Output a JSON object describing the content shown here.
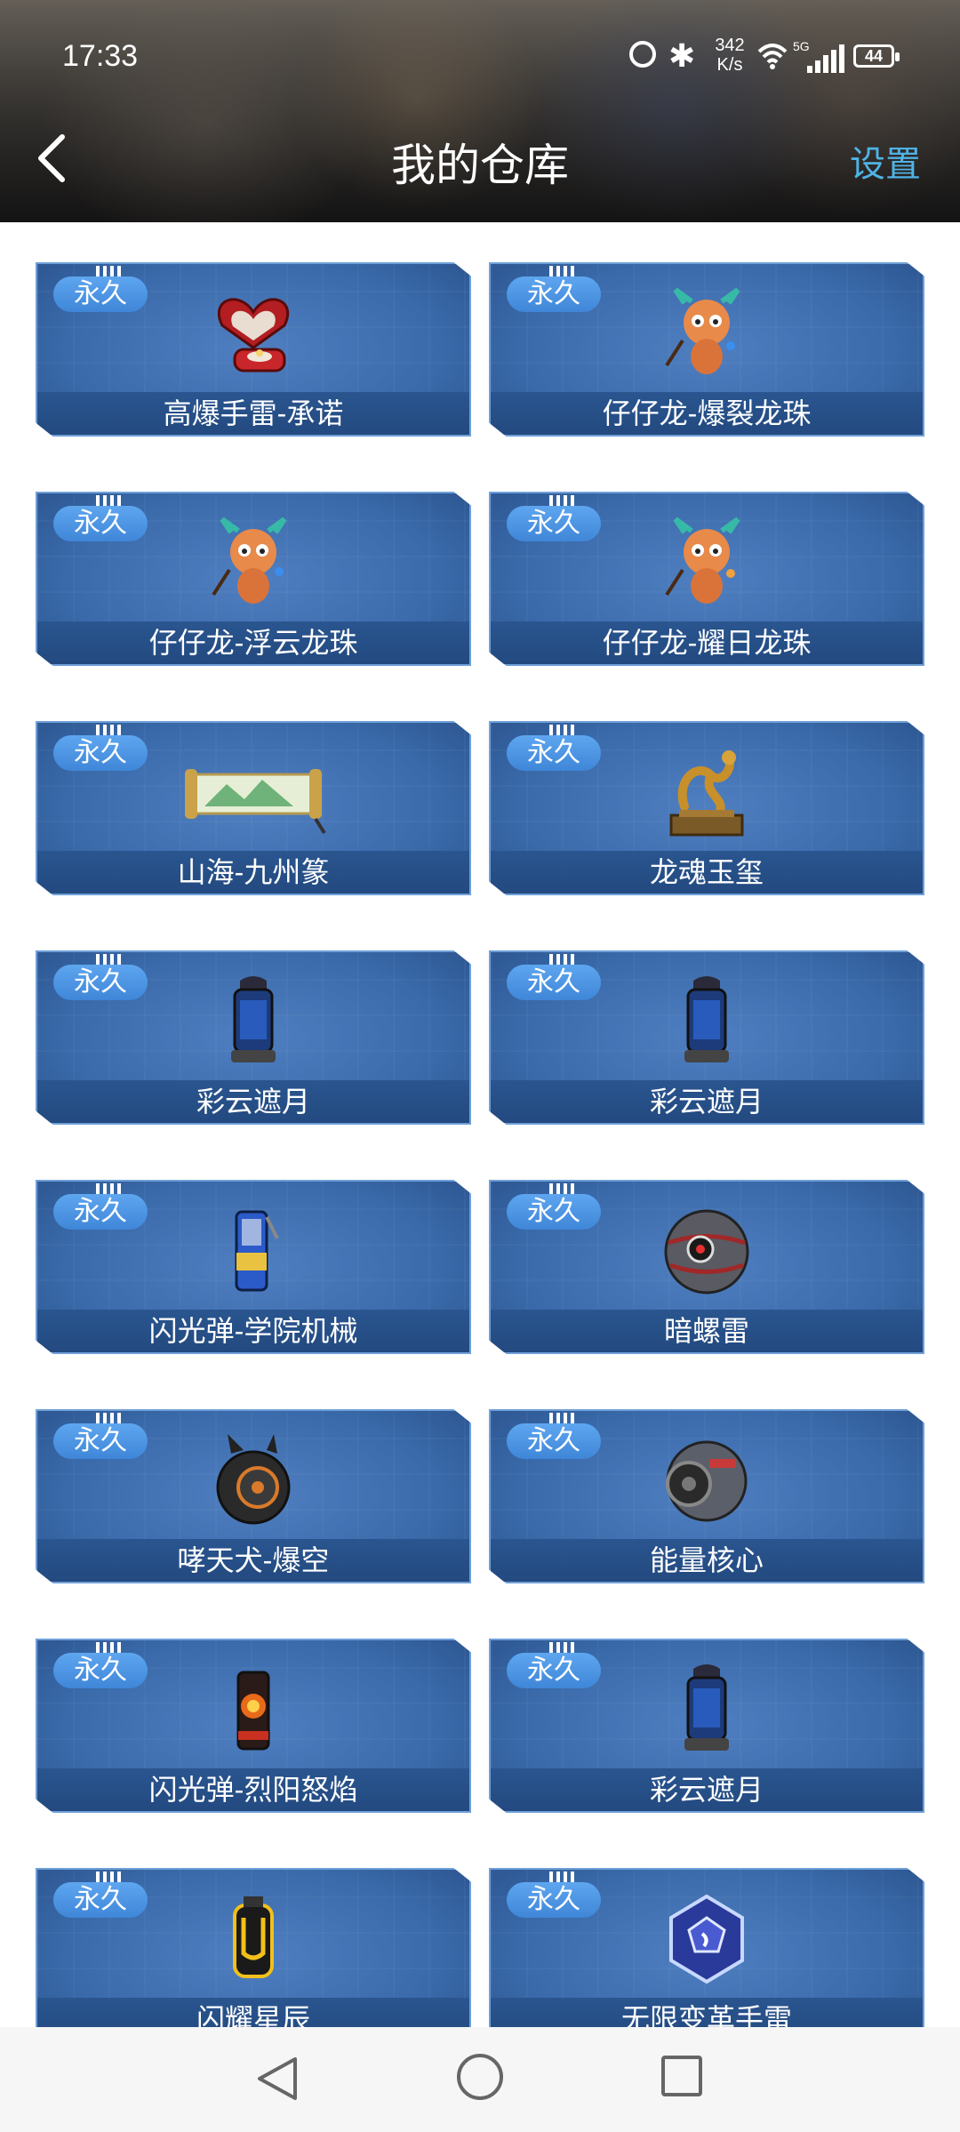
{
  "status": {
    "time": "17:33",
    "net_speed": "342",
    "net_unit": "K/s",
    "signal_label": "5G",
    "battery": "44"
  },
  "header": {
    "title": "我的仓库",
    "settings_label": "设置"
  },
  "items": [
    {
      "badge": "永久",
      "name": "高爆手雷-承诺",
      "icon": "heart-ring-box-icon"
    },
    {
      "badge": "永久",
      "name": "仔仔龙-爆裂龙珠",
      "icon": "dragon-mascot-icon"
    },
    {
      "badge": "永久",
      "name": "仔仔龙-浮云龙珠",
      "icon": "dragon-mascot-icon"
    },
    {
      "badge": "永久",
      "name": "仔仔龙-耀日龙珠",
      "icon": "dragon-mascot-icon"
    },
    {
      "badge": "永久",
      "name": "山海-九州篆",
      "icon": "scroll-icon"
    },
    {
      "badge": "永久",
      "name": "龙魂玉玺",
      "icon": "golden-dragon-seal-icon"
    },
    {
      "badge": "永久",
      "name": "彩云遮月",
      "icon": "canister-grenade-icon"
    },
    {
      "badge": "永久",
      "name": "彩云遮月",
      "icon": "canister-grenade-icon"
    },
    {
      "badge": "永久",
      "name": "闪光弹-学院机械",
      "icon": "flashbang-can-icon"
    },
    {
      "badge": "永久",
      "name": "暗螺雷",
      "icon": "sphere-mine-icon"
    },
    {
      "badge": "永久",
      "name": "哮天犬-爆空",
      "icon": "dog-wheel-icon"
    },
    {
      "badge": "永久",
      "name": "能量核心",
      "icon": "energy-core-icon"
    },
    {
      "badge": "永久",
      "name": "闪光弹-烈阳怒焰",
      "icon": "flame-flashbang-icon"
    },
    {
      "badge": "永久",
      "name": "彩云遮月",
      "icon": "canister-grenade-icon"
    },
    {
      "badge": "永久",
      "name": "闪耀星辰",
      "icon": "star-grenade-icon"
    },
    {
      "badge": "永久",
      "name": "无限变革手雷",
      "icon": "dodecahedron-grenade-icon"
    }
  ]
}
